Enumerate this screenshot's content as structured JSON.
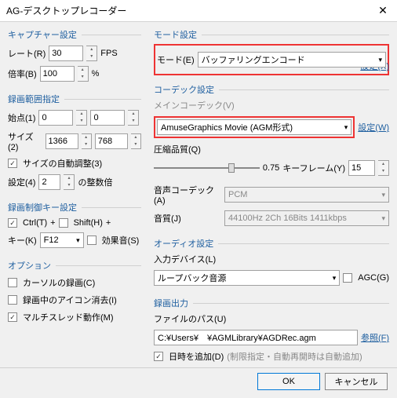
{
  "title": "AG-デスクトップレコーダー",
  "capture": {
    "title": "キャプチャー設定",
    "rate_label": "レート(R)",
    "rate_value": "30",
    "fps": "FPS",
    "scale_label": "倍率(B)",
    "scale_value": "100",
    "percent": "%"
  },
  "range": {
    "title": "録画範囲指定",
    "origin_label": "始点(1)",
    "ox": "0",
    "oy": "0",
    "size_label": "サイズ(2)",
    "sw": "1366",
    "sh": "768",
    "auto_adjust": "サイズの自動調整(3)",
    "setting_label": "設定(4)",
    "setting_value": "2",
    "setting_suffix": "の整数倍"
  },
  "control": {
    "title": "録画制御キー設定",
    "ctrl": "Ctrl(T)",
    "plus": "+",
    "shift": "Shift(H)",
    "key_label": "キー(K)",
    "key_value": "F12",
    "sfx": "効果音(S)"
  },
  "options": {
    "title": "オプション",
    "cursor": "カーソルの録画(C)",
    "erase_icon": "録画中のアイコン消去(I)",
    "multithread": "マルチスレッド動作(M)"
  },
  "mode": {
    "title": "モード設定",
    "label": "モード(E)",
    "value": "バッファリングエンコード",
    "setting": "設定(X)"
  },
  "codec": {
    "title": "コーデック設定",
    "main_label": "メインコーデック(V)",
    "main_value": "AmuseGraphics Movie (AGM形式)",
    "setting": "設定(W)",
    "quality_label": "圧縮品質(Q)",
    "quality_value": "0.75",
    "keyframe_label": "キーフレーム(Y)",
    "keyframe_value": "15",
    "audio_codec_label": "音声コーデック(A)",
    "audio_codec_value": "PCM",
    "audio_quality_label": "音質(J)",
    "audio_quality_value": "44100Hz 2Ch 16Bits 1411kbps"
  },
  "audio": {
    "title": "オーディオ設定",
    "device_label": "入力デバイス(L)",
    "device_value": "ループバック音源",
    "agc": "AGC(G)"
  },
  "output": {
    "title": "録画出力",
    "path_label": "ファイルのパス(U)",
    "path_value": "C:¥Users¥　¥AGMLibrary¥AGDRec.agm",
    "browse": "参照(F)",
    "datetime": "日時を追加(D)",
    "note": "(制限指定・自動再開時は自動追加)"
  },
  "footer": {
    "ok": "OK",
    "cancel": "キャンセル"
  }
}
